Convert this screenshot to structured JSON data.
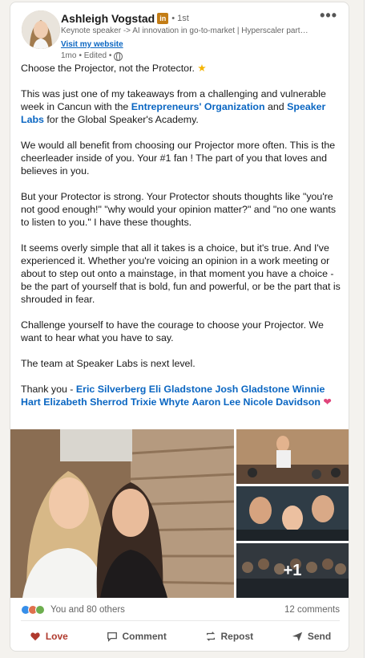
{
  "author": {
    "name": "Ashleigh Vogstad",
    "linkedin_badge": "in",
    "degree": "• 1st",
    "headline": "Keynote speaker -> AI innovation in go-to-market | Hyperscaler part…",
    "website_label": "Visit my website",
    "time": "1mo",
    "edited": "• Edited •"
  },
  "menu": {
    "more_label": "•••"
  },
  "post": {
    "p1_text": "Choose the Projector, not the Protector. ",
    "p2_pre": "This was just one of my takeaways from a challenging and vulnerable week in Cancun with the ",
    "p2_link1": "Entrepreneurs' Organization",
    "p2_mid": " and ",
    "p2_link2": "Speaker Labs",
    "p2_post": " for the Global Speaker's Academy.",
    "p3": "We would all benefit from choosing our Projector more often. This is the cheerleader inside of you. Your #1 fan ! The part of you that loves and believes in you.",
    "p4": "But your Protector is strong. Your Protector shouts thoughts like \"you're not good enough!\" \"why would your opinion matter?\" and \"no one wants to listen to you.\" I have these thoughts.",
    "p5": "It seems overly simple that all it takes is a choice, but it's true. And I've experienced it. Whether you're voicing an opinion in a work meeting or about to step out onto a mainstage, in that moment you have a choice - be the part of yourself that is bold, fun and powerful, or be the part that is shrouded in fear.",
    "p6": "Challenge yourself to have the courage to choose your Projector. We want to hear what you have to say.",
    "p7": "The team at Speaker Labs is next level.",
    "thanks_prefix": "Thank you - ",
    "mentions": [
      "Eric Silverberg",
      "Eli Gladstone",
      "Josh Gladstone",
      "Winnie Hart",
      "Elizabeth Sherrod",
      "Trixie Whyte",
      "Aaron Lee",
      "Nicole Davidson"
    ],
    "heart": "❤"
  },
  "images": {
    "more_count": "+1"
  },
  "social": {
    "reactions_text": "You and 80 others",
    "comments_text": "12 comments"
  },
  "actions": {
    "love": "Love",
    "comment": "Comment",
    "repost": "Repost",
    "send": "Send"
  },
  "colors": {
    "link": "#0a66c2",
    "love": "#b03a2e",
    "reaction_like": "#378fe9",
    "reaction_love": "#df704d",
    "reaction_support": "#6dae4f"
  }
}
